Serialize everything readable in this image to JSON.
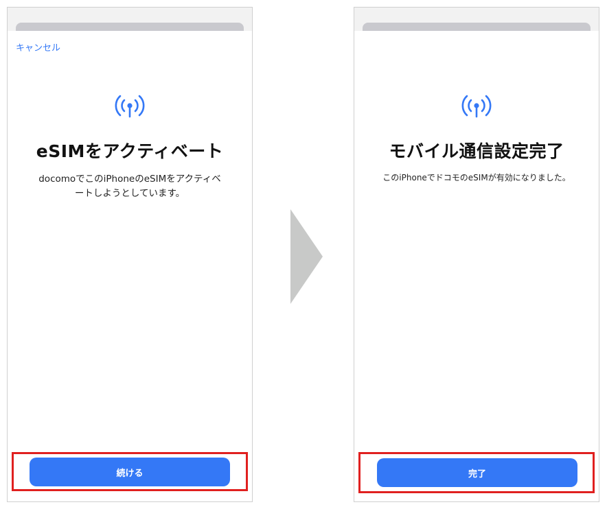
{
  "colors": {
    "accent": "#3478f6",
    "highlight": "#e0201f",
    "arrow": "#c8c9c8"
  },
  "left_screen": {
    "cancel_label": "キャンセル",
    "icon": "antenna-signal-icon",
    "title": "eSIMをアクティベート",
    "description": "docomoでこのiPhoneのeSIMをアクティベートしようとしています。",
    "button_label": "続ける"
  },
  "right_screen": {
    "icon": "antenna-signal-icon",
    "title": "モバイル通信設定完了",
    "description": "このiPhoneでドコモのeSIMが有効になりました。",
    "button_label": "完了"
  }
}
